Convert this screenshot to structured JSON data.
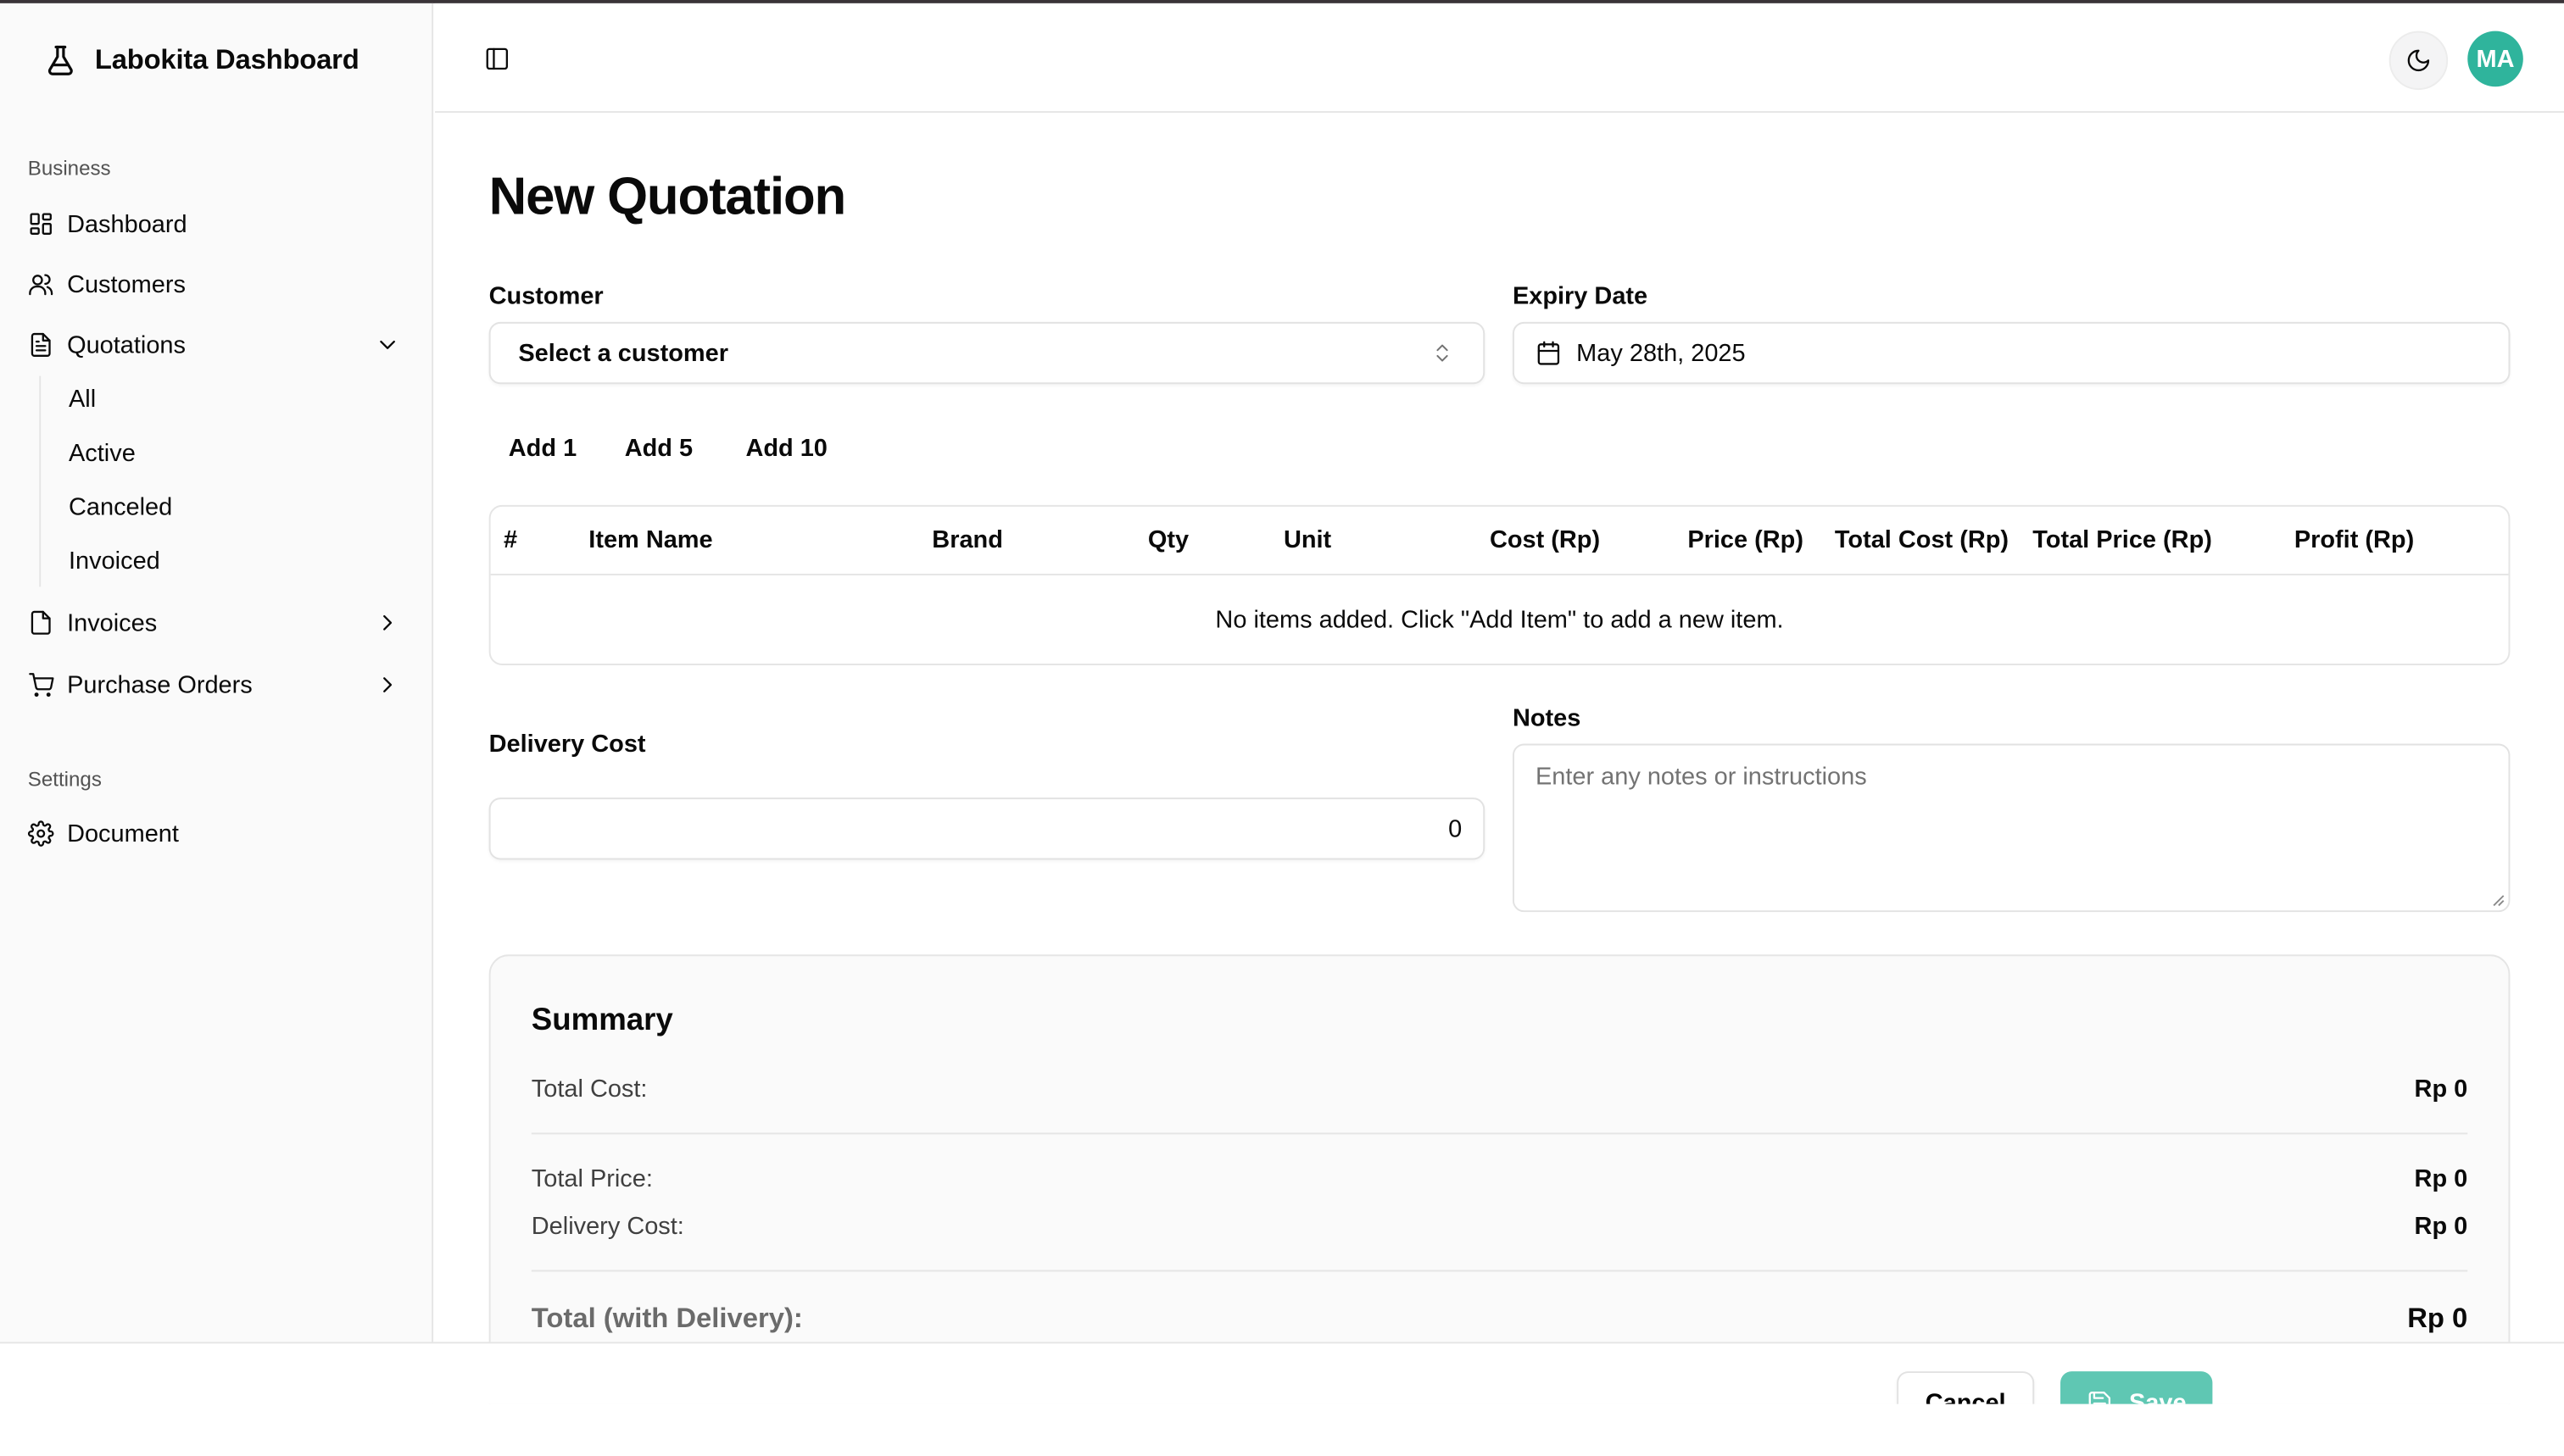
{
  "brand": {
    "title": "Labokita Dashboard",
    "icon": "flask-icon"
  },
  "sidebar": {
    "business_label": "Business",
    "items": [
      {
        "label": "Dashboard",
        "icon": "layout-grid-icon"
      },
      {
        "label": "Customers",
        "icon": "users-icon"
      },
      {
        "label": "Quotations",
        "icon": "file-text-icon",
        "expanded": true
      },
      {
        "label": "Invoices",
        "icon": "file-icon"
      },
      {
        "label": "Purchase Orders",
        "icon": "cart-icon"
      }
    ],
    "quotations_sub": [
      "All",
      "Active",
      "Canceled",
      "Invoiced"
    ],
    "settings_label": "Settings",
    "settings_items": [
      {
        "label": "Document",
        "icon": "gear-icon"
      }
    ]
  },
  "topbar": {
    "avatar_initials": "MA",
    "accent": "#2fb49c"
  },
  "page": {
    "title": "New Quotation"
  },
  "form": {
    "customer_label": "Customer",
    "customer_value": "Select a customer",
    "expiry_label": "Expiry Date",
    "expiry_value": "May 28th, 2025",
    "add_buttons": [
      "Add 1",
      "Add 5",
      "Add 10"
    ],
    "delivery_label": "Delivery Cost",
    "delivery_value": "0",
    "notes_label": "Notes",
    "notes_placeholder": "Enter any notes or instructions"
  },
  "table": {
    "columns": [
      "#",
      "Item Name",
      "Brand",
      "Qty",
      "Unit",
      "Cost (Rp)",
      "Price (Rp)",
      "Total Cost (Rp)",
      "Total Price (Rp)",
      "Profit (Rp)"
    ],
    "empty_message": "No items added. Click \"Add Item\" to add a new item."
  },
  "summary": {
    "title": "Summary",
    "total_cost_label": "Total Cost:",
    "total_cost_value": "Rp 0",
    "total_price_label": "Total Price:",
    "total_price_value": "Rp 0",
    "delivery_cost_label": "Delivery Cost:",
    "delivery_cost_value": "Rp 0",
    "grand_total_label": "Total (with Delivery):",
    "grand_total_value": "Rp 0"
  },
  "footer": {
    "cancel_label": "Cancel",
    "save_label": "Save",
    "save_color": "#5fc7b3"
  }
}
